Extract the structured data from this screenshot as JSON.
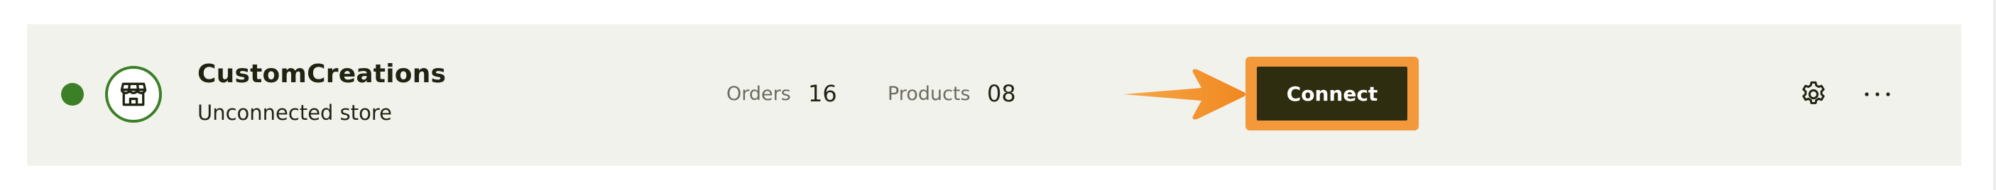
{
  "store": {
    "name": "CustomCreations",
    "status_text": "Unconnected store",
    "status_color": "#3b7f27"
  },
  "metrics": {
    "orders_label": "Orders",
    "orders_value": "16",
    "products_label": "Products",
    "products_value": "08"
  },
  "actions": {
    "connect_label": "Connect",
    "connect_highlight_color": "#f3993b",
    "connect_bg_color": "#2f2d0f",
    "settings_icon": "gear-icon",
    "more_icon": "more-horizontal-icon"
  }
}
